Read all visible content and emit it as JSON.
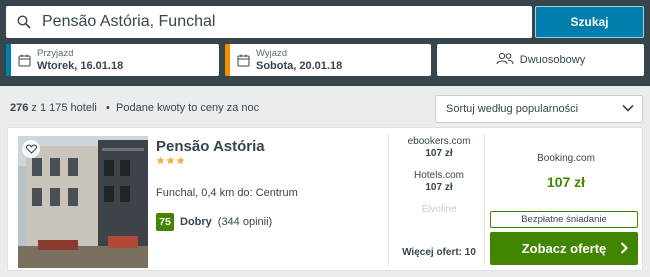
{
  "search": {
    "value": "Pensão Astória, Funchal",
    "button_label": "Szukaj"
  },
  "checkin": {
    "label": "Przyjazd",
    "value": "Wtorek, 16.01.18"
  },
  "checkout": {
    "label": "Wyjazd",
    "value": "Sobota, 20.01.18"
  },
  "room": {
    "label": "Dwuosobowy"
  },
  "results": {
    "count": "276",
    "total": "z 1 175 hoteli",
    "separator": "•",
    "note": "Podane kwoty to ceny za noc"
  },
  "sort": {
    "selected": "Sortuj według popularności"
  },
  "hotel": {
    "name": "Pensão Astória",
    "stars": 3,
    "location": "Funchal, 0,4 km do: Centrum",
    "rating_score": "75",
    "rating_word": "Dobry",
    "rating_count": "(344 opinii)",
    "offers": [
      {
        "provider": "ebookers.com",
        "price": "107 zł"
      },
      {
        "provider": "Hotels.com",
        "price": "107 zł"
      },
      {
        "provider": "Elvoline",
        "price": ""
      }
    ],
    "more_offers": "Więcej ofert: 10",
    "best_provider": "Booking.com",
    "best_price": "107 zł",
    "breakfast": "Bezpłatne śniadanie",
    "deal_button": "Zobacz ofertę"
  },
  "colors": {
    "header_bg": "#37454d",
    "search_button": "#007fad",
    "checkin_accent": "#007fad",
    "checkout_accent": "#f48f00",
    "deal_green": "#428500",
    "star_gold": "#f6ab3f"
  }
}
